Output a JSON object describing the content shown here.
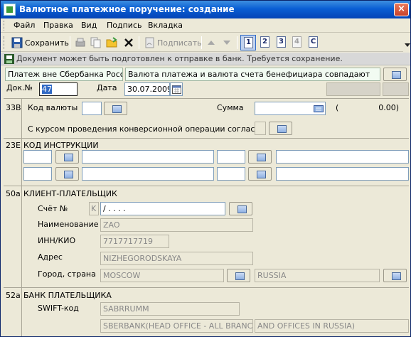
{
  "window": {
    "title": "Валютное платежное поручение: создание",
    "close_label": "×"
  },
  "menu": {
    "items": [
      "Файл",
      "Правка",
      "Вид",
      "Подпись",
      "Вкладка"
    ]
  },
  "toolbar": {
    "save_label": "Сохранить",
    "sign_label": "Подписать",
    "tabs": [
      "1",
      "2",
      "3",
      "4",
      "C"
    ]
  },
  "status": {
    "message": "Документ может быть подготовлен к отправке в банк. Требуется сохранение."
  },
  "header": {
    "payment_type": "Платеж вне Сбербанка России",
    "currency_note": "Валюта платежа и валюта счета бенефициара совпадают",
    "doc_no_label": "Док.№",
    "doc_no_value": "47",
    "date_label": "Дата",
    "date_value": "30.07.2009"
  },
  "section33b": {
    "code": "33B",
    "currency_label": "Код валюты",
    "amount_label": "Сумма",
    "amount_display": "(                0.00)",
    "conversion_label": "С курсом проведения конверсионной операции согласны"
  },
  "section23e": {
    "code": "23E",
    "title": "КОД ИНСТРУКЦИИ"
  },
  "section50a": {
    "code": "50a",
    "title": "КЛИЕНТ-ПЛАТЕЛЬЩИК",
    "account_label": "Счёт №",
    "account_prefix": "K",
    "account_value": "/ .  .  .          .",
    "name_label": "Наименование",
    "name_value": "ZAO",
    "inn_label": "ИНН/КИО",
    "inn_value": "7717717719",
    "address_label": "Адрес",
    "address_value": "NIZHEGORODSKAYA",
    "city_label": "Город, страна",
    "city_value": "MOSCOW",
    "country_value": "RUSSIA"
  },
  "section52a": {
    "code": "52a",
    "title": "БАНК ПЛАТЕЛЬЩИКА",
    "swift_label": "SWIFT-код",
    "swift_value": "SABRRUMM",
    "bank_name": "SBERBANK(HEAD OFFICE - ALL BRANCHES",
    "bank_name2": "AND OFFICES IN RUSSIA)"
  }
}
